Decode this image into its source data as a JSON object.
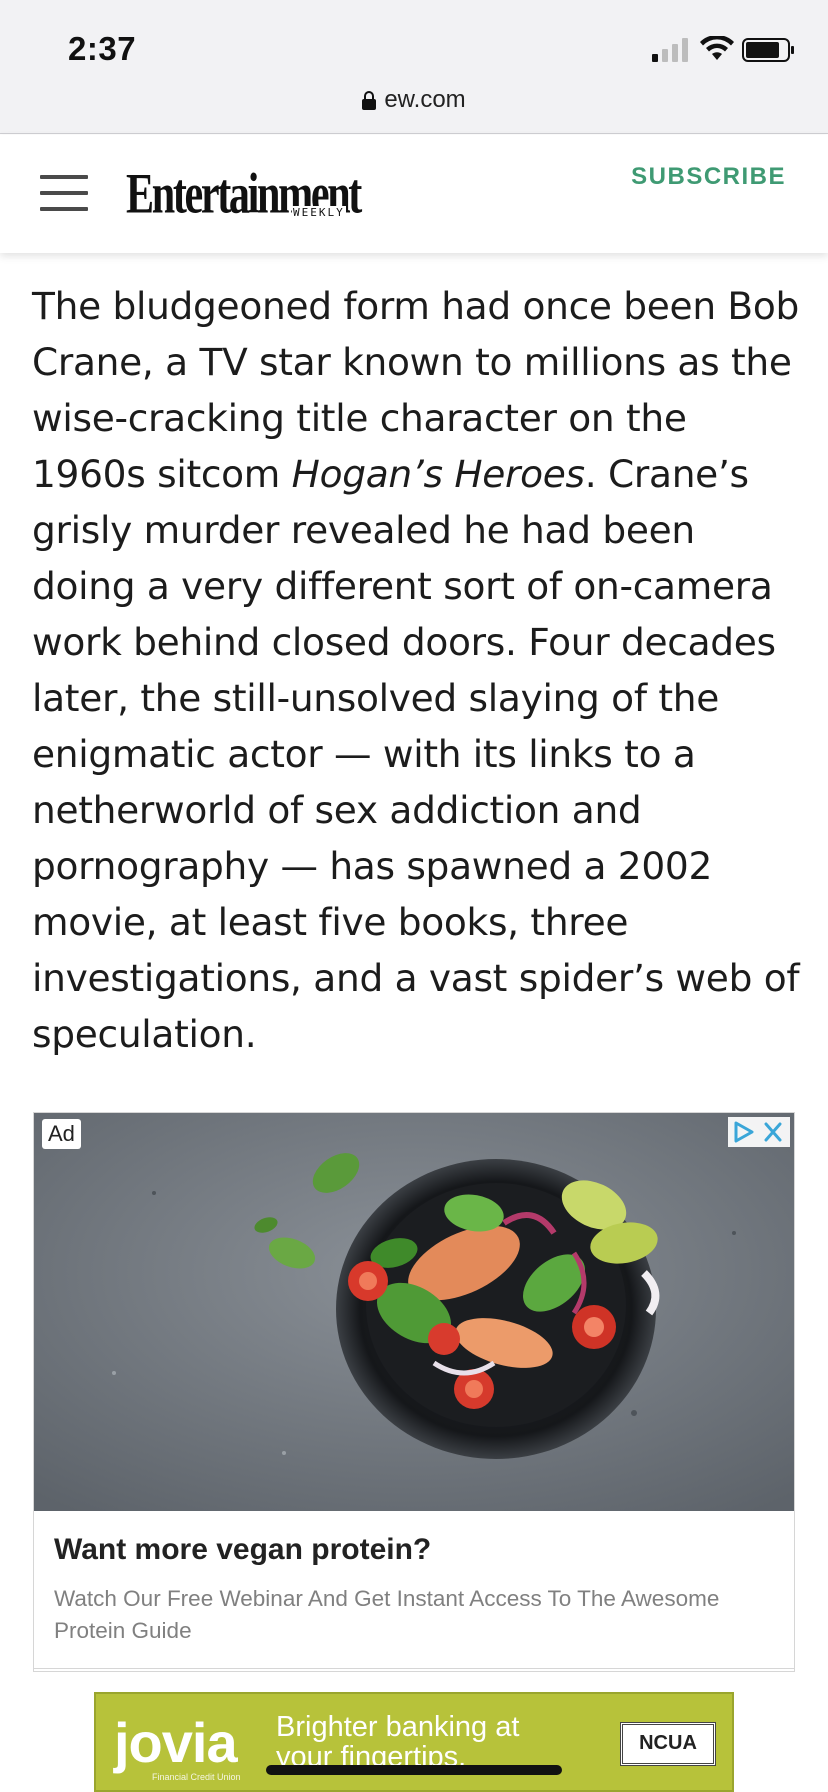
{
  "status_bar": {
    "time": "2:37",
    "url": "ew.com"
  },
  "header": {
    "logo": "Entertainment",
    "logo_sub": "WEEKLY",
    "subscribe_label": "SUBSCRIBE"
  },
  "article": {
    "text_before_italic": "The bludgeoned form had once been Bob Crane, a TV star known to millions as the wise-cracking title character on the 1960s sitcom ",
    "italic": "Hogan’s Heroes",
    "text_after_italic": ". Crane’s grisly murder revealed he had been doing a very different sort of on-camera work behind closed doors. Four decades later, the still-unsolved slaying of the enigmatic actor — with its links to a netherworld of sex addiction and pornography — has spawned a 2002 movie, at least five books, three investigations, and a vast spider’s web of speculation."
  },
  "ad": {
    "badge": "Ad",
    "title": "Want more vegan protein?",
    "description": "Watch Our Free Webinar And Get Instant Access To The Awesome Protein Guide"
  },
  "banner": {
    "logo": "jovia",
    "logo_sub": "Financial Credit Union",
    "tagline": "Brighter banking at your fingertips.",
    "badge": "NCUA"
  },
  "colors": {
    "subscribe": "#3f9a73",
    "banner_bg": "#b7c23a",
    "status_bg": "#f2f2f4"
  }
}
